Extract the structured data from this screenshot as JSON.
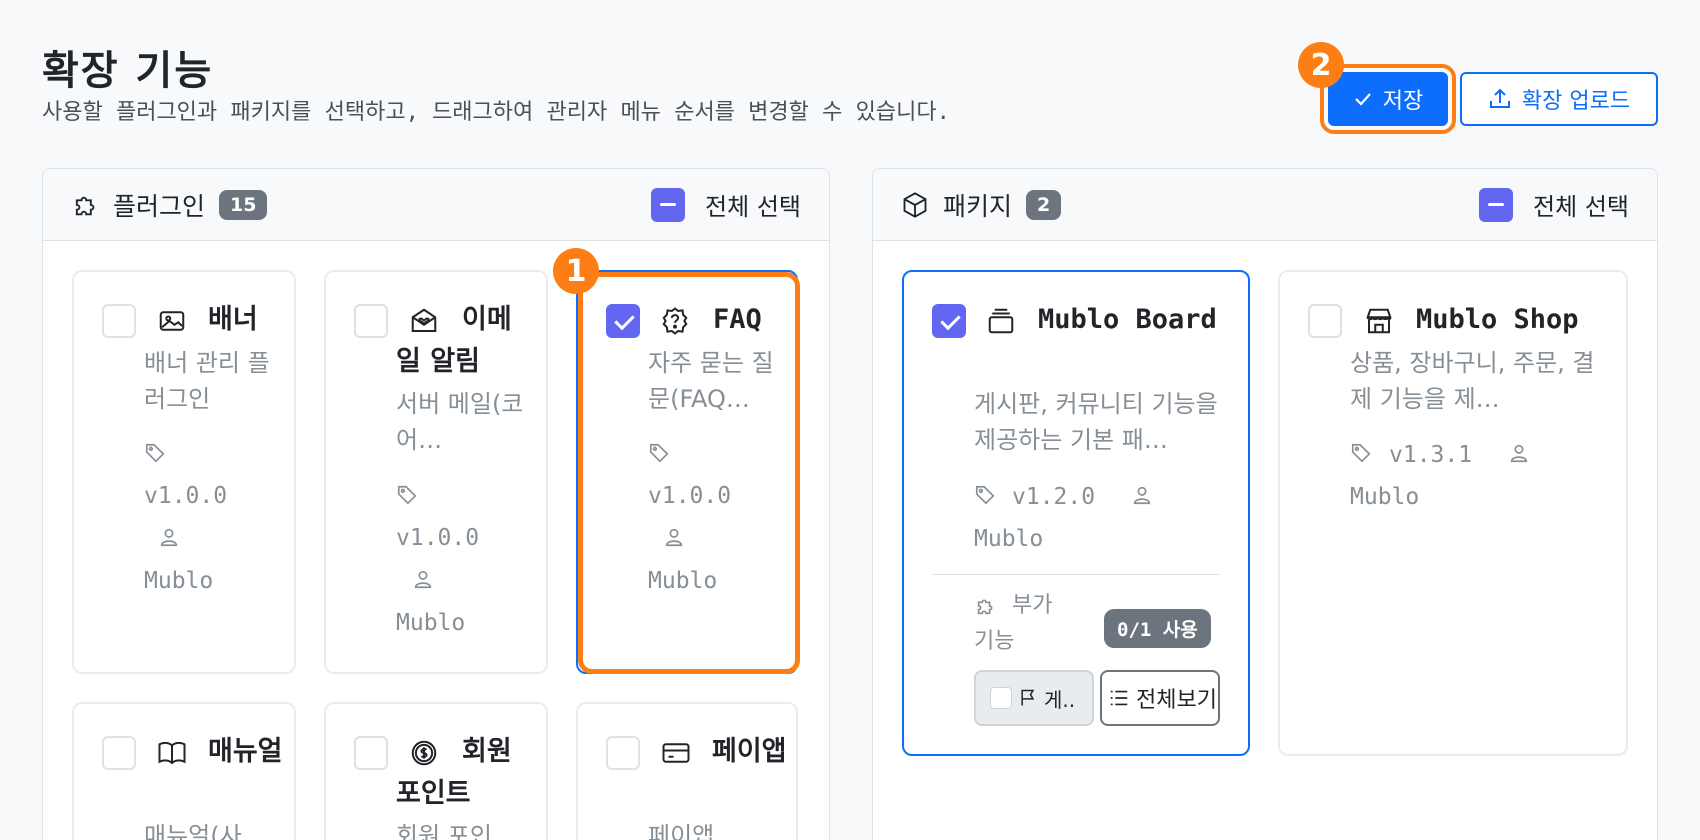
{
  "header": {
    "title": "확장 기능",
    "subtitle": "사용할 플러그인과 패키지를 선택하고, 드래그하여 관리자 메뉴 순서를 변경할 수 있습니다.",
    "save_label": "저장",
    "upload_label": "확장 업로드"
  },
  "markers": {
    "m1": "1",
    "m2": "2"
  },
  "plugins": {
    "title": "플러그인",
    "count": "15",
    "select_all": "전체 선택",
    "cards": [
      {
        "name": "배너",
        "desc": "배너 관리 플러그인",
        "version": "v1.0.0",
        "author": "Mublo",
        "icon": "image-icon",
        "checked": false
      },
      {
        "name": "이메일 알림",
        "desc": "서버 메일(코어…",
        "version": "v1.0.0",
        "author": "Mublo",
        "icon": "mail-heart-icon",
        "checked": false
      },
      {
        "name": "FAQ",
        "desc": "자주 묻는 질문(FAQ…",
        "version": "v1.0.0",
        "author": "Mublo",
        "icon": "question-badge-icon",
        "checked": true
      },
      {
        "name": "매뉴얼",
        "desc": "매뉴얼(사",
        "icon": "book-icon",
        "checked": false
      },
      {
        "name": "회원 포인트",
        "desc": "회원 포인",
        "icon": "coin-icon",
        "checked": false
      },
      {
        "name": "페이앱",
        "desc": "페이앱",
        "icon": "credit-card-icon",
        "checked": false
      }
    ]
  },
  "packages": {
    "title": "패키지",
    "count": "2",
    "select_all": "전체 선택",
    "cards": [
      {
        "name": "Mublo Board",
        "desc": "게시판, 커뮤니티 기능을 제공하는 기본 패…",
        "version": "v1.2.0",
        "author": "Mublo",
        "icon": "stack-icon",
        "checked": true,
        "addon_label": "부가 기능",
        "usage": "0/1 사용",
        "addon_chip": "게..",
        "view_all": "전체보기"
      },
      {
        "name": "Mublo Shop",
        "desc": "상품, 장바구니, 주문, 결제 기능을 제…",
        "version": "v1.3.1",
        "author": "Mublo",
        "icon": "shop-icon",
        "checked": false
      }
    ]
  },
  "colors": {
    "accent": "#0d6efd",
    "highlight": "#fd7e14",
    "checkbox": "#6366f1",
    "badge": "#6c757d"
  }
}
